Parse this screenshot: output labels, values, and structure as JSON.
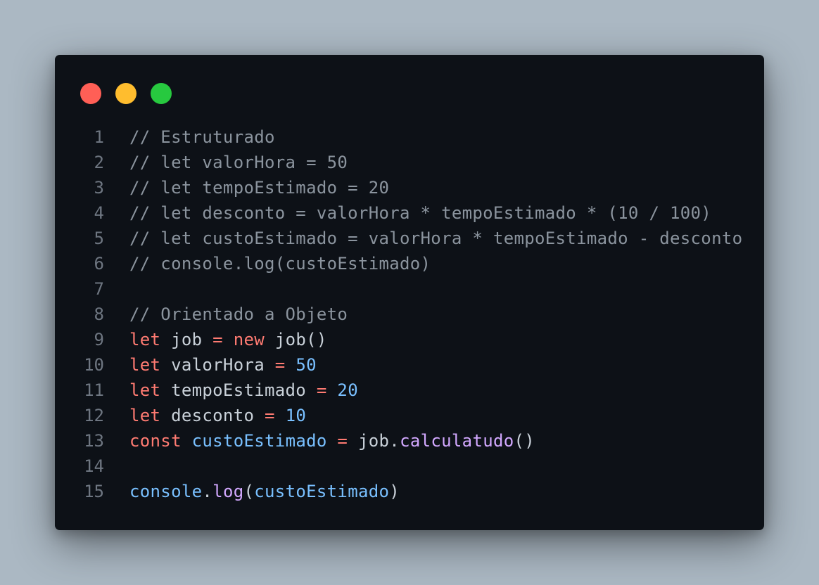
{
  "colors": {
    "background": "#abb8c3",
    "window": "#0d1117",
    "close": "#ff5f56",
    "minimize": "#ffbd2e",
    "maximize": "#27c93f",
    "line_number": "#6e7681",
    "comment": "#8b949e",
    "keyword": "#ff7b72",
    "plain": "#c9d1d9",
    "number": "#79c0ff",
    "variable": "#79c0ff",
    "function": "#d2a8ff"
  },
  "window_controls": [
    {
      "name": "close-dot",
      "color": "#ff5f56"
    },
    {
      "name": "minimize-dot",
      "color": "#ffbd2e"
    },
    {
      "name": "maximize-dot",
      "color": "#27c93f"
    }
  ],
  "code_lines": [
    {
      "num": "1",
      "tokens": [
        {
          "t": "// Estruturado",
          "c": "c"
        }
      ]
    },
    {
      "num": "2",
      "tokens": [
        {
          "t": "// let valorHora = 50",
          "c": "c"
        }
      ]
    },
    {
      "num": "3",
      "tokens": [
        {
          "t": "// let tempoEstimado = 20",
          "c": "c"
        }
      ]
    },
    {
      "num": "4",
      "tokens": [
        {
          "t": "// let desconto = valorHora * tempoEstimado * (10 / 100)",
          "c": "c"
        }
      ]
    },
    {
      "num": "5",
      "tokens": [
        {
          "t": "// let custoEstimado = valorHora * tempoEstimado - desconto",
          "c": "c"
        }
      ]
    },
    {
      "num": "6",
      "tokens": [
        {
          "t": "// console.log(custoEstimado)",
          "c": "c"
        }
      ]
    },
    {
      "num": "7",
      "tokens": []
    },
    {
      "num": "8",
      "tokens": [
        {
          "t": "// Orientado a Objeto",
          "c": "c"
        }
      ]
    },
    {
      "num": "9",
      "tokens": [
        {
          "t": "let",
          "c": "k"
        },
        {
          "t": " job ",
          "c": "p"
        },
        {
          "t": "=",
          "c": "k"
        },
        {
          "t": " ",
          "c": "p"
        },
        {
          "t": "new",
          "c": "k"
        },
        {
          "t": " job()",
          "c": "p"
        }
      ]
    },
    {
      "num": "10",
      "tokens": [
        {
          "t": "let",
          "c": "k"
        },
        {
          "t": " valorHora ",
          "c": "p"
        },
        {
          "t": "=",
          "c": "k"
        },
        {
          "t": " ",
          "c": "p"
        },
        {
          "t": "50",
          "c": "n"
        }
      ]
    },
    {
      "num": "11",
      "tokens": [
        {
          "t": "let",
          "c": "k"
        },
        {
          "t": " tempoEstimado ",
          "c": "p"
        },
        {
          "t": "=",
          "c": "k"
        },
        {
          "t": " ",
          "c": "p"
        },
        {
          "t": "20",
          "c": "n"
        }
      ]
    },
    {
      "num": "12",
      "tokens": [
        {
          "t": "let",
          "c": "k"
        },
        {
          "t": " desconto ",
          "c": "p"
        },
        {
          "t": "=",
          "c": "k"
        },
        {
          "t": " ",
          "c": "p"
        },
        {
          "t": "10",
          "c": "n"
        }
      ]
    },
    {
      "num": "13",
      "tokens": [
        {
          "t": "const",
          "c": "k"
        },
        {
          "t": " ",
          "c": "p"
        },
        {
          "t": "custoEstimado",
          "c": "v"
        },
        {
          "t": " ",
          "c": "p"
        },
        {
          "t": "=",
          "c": "k"
        },
        {
          "t": " job.",
          "c": "p"
        },
        {
          "t": "calculatudo",
          "c": "f"
        },
        {
          "t": "()",
          "c": "p"
        }
      ]
    },
    {
      "num": "14",
      "tokens": []
    },
    {
      "num": "15",
      "tokens": [
        {
          "t": "console",
          "c": "v"
        },
        {
          "t": ".",
          "c": "p"
        },
        {
          "t": "log",
          "c": "f"
        },
        {
          "t": "(",
          "c": "p"
        },
        {
          "t": "custoEstimado",
          "c": "v"
        },
        {
          "t": ")",
          "c": "p"
        }
      ]
    }
  ]
}
